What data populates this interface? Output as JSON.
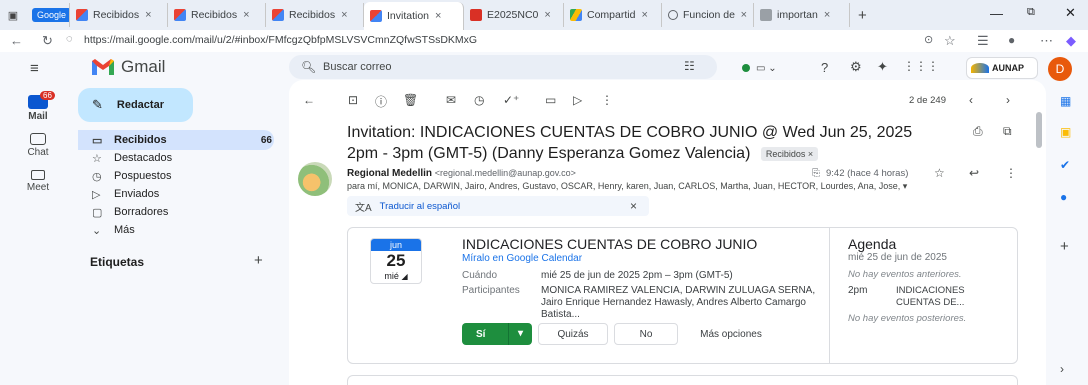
{
  "browser": {
    "tabs": [
      {
        "label": "Google",
        "kind": "google",
        "close": ""
      },
      {
        "label": "Recibidos",
        "kind": "gmail",
        "close": "×"
      },
      {
        "label": "Recibidos",
        "kind": "gmail",
        "close": "×"
      },
      {
        "label": "Recibidos",
        "kind": "gmail",
        "close": "×"
      },
      {
        "label": "Invitation",
        "kind": "gmail",
        "close": "×"
      },
      {
        "label": "E2025NC0",
        "kind": "pdf",
        "close": "×"
      },
      {
        "label": "Compartid",
        "kind": "drive",
        "close": "×"
      },
      {
        "label": "Funcion de",
        "kind": "search",
        "close": "×"
      },
      {
        "label": "importan",
        "kind": "doc",
        "close": "×"
      }
    ],
    "new_tab": "+",
    "url": "https://mail.google.com/mail/u/2/#inbox/FMfcgzQbfpMSLVSVCmnZQfwSTSsDKMxG"
  },
  "gmail": {
    "logo_text": "Gmail",
    "search_placeholder": "Buscar correo",
    "brand_text": "AUNAP",
    "avatar_letter": "D",
    "rail": {
      "mail_label": "Mail",
      "mail_badge": "66",
      "chat_label": "Chat",
      "meet_label": "Meet"
    },
    "compose_label": "Redactar",
    "nav": [
      {
        "label": "Recibidos",
        "count": "66",
        "icon": "▭"
      },
      {
        "label": "Destacados",
        "count": "",
        "icon": "☆"
      },
      {
        "label": "Pospuestos",
        "count": "",
        "icon": "◷"
      },
      {
        "label": "Enviados",
        "count": "",
        "icon": "▷"
      },
      {
        "label": "Borradores",
        "count": "",
        "icon": "▢"
      },
      {
        "label": "Más",
        "count": "",
        "icon": "⌄"
      }
    ],
    "labels_heading": "Etiquetas",
    "labels_add": "+"
  },
  "email": {
    "pagination": "2 de 249",
    "subject": "Invitation: INDICACIONES CUENTAS DE COBRO JUNIO @ Wed Jun 25, 2025 2pm - 3pm (GMT-5) (Danny Esperanza Gomez Valencia)",
    "label_chip": "Recibidos ×",
    "sender_name": "Regional Medellin",
    "sender_email": "<regional.medellin@aunap.gov.co>",
    "time": "9:42 (hace 4 horas)",
    "recipients": "para mí, MONICA, DARWIN, Jairo, Andres, Gustavo, OSCAR, Henry, karen, Juan, CARLOS, Martha, Juan, HECTOR, Lourdes, Ana, Jose,",
    "translate_label": "Traducir al español",
    "translate_close": "×"
  },
  "invite": {
    "month": "jun",
    "day": "25",
    "weekday": "mié",
    "title": "INDICACIONES CUENTAS DE COBRO JUNIO",
    "calendar_link": "Míralo en Google Calendar",
    "when_label": "Cuándo",
    "when_value": "mié 25 de jun de 2025 2pm – 3pm (GMT-5)",
    "participants_label": "Participantes",
    "participants_value": "MONICA RAMIREZ VALENCIA, DARWIN ZULUAGA SERNA, Jairo Enrique Hernandez Hawasly, Andres Alberto Camargo Batista...",
    "yes_label": "Sí",
    "maybe_label": "Quizás",
    "no_label": "No",
    "more_label": "Más opciones"
  },
  "agenda": {
    "title": "Agenda",
    "date": "mié 25 de jun de 2025",
    "no_previous": "No hay eventos anteriores.",
    "event_time": "2pm",
    "event_title": "INDICACIONES CUENTAS DE...",
    "no_next": "No hay eventos posteriores."
  }
}
